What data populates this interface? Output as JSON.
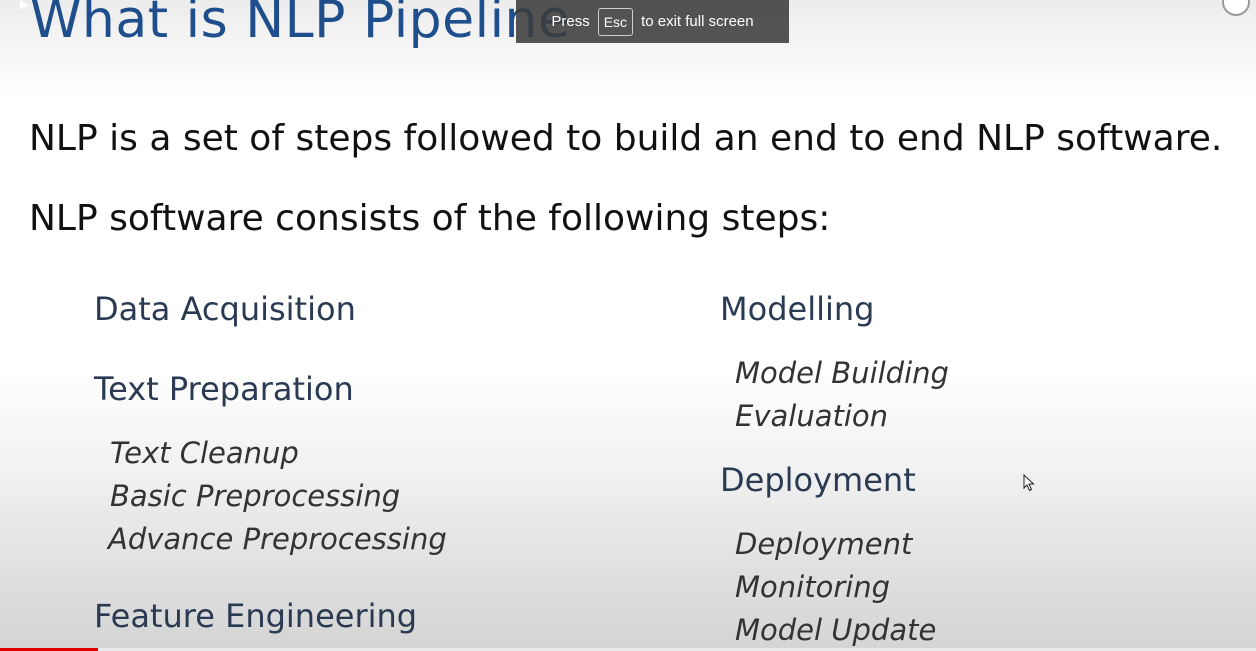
{
  "slide": {
    "title": "What is NLP Pipeline",
    "intro_line_1": "NLP is a set of steps followed to build an end to end NLP software.",
    "intro_line_2": "NLP software consists of the following steps:",
    "left_column": {
      "data_acquisition": "Data Acquisition",
      "text_preparation": "Text Preparation",
      "text_preparation_steps": [
        "Text Cleanup",
        "Basic Preprocessing",
        "Advance Preprocessing"
      ],
      "feature_engineering": "Feature Engineering"
    },
    "right_column": {
      "modelling": "Modelling",
      "modelling_steps": [
        "Model Building",
        "Evaluation"
      ],
      "deployment": "Deployment",
      "deployment_steps": [
        "Deployment",
        "Monitoring",
        "Model Update"
      ]
    }
  },
  "fullscreen_notice": {
    "prefix": "Press",
    "key": "Esc",
    "suffix": "to exit full screen"
  },
  "player": {
    "progress_fraction": 0.078,
    "progress_color": "#e00000"
  },
  "colors": {
    "title": "#1f4e8c",
    "heading": "#2a3a52"
  }
}
